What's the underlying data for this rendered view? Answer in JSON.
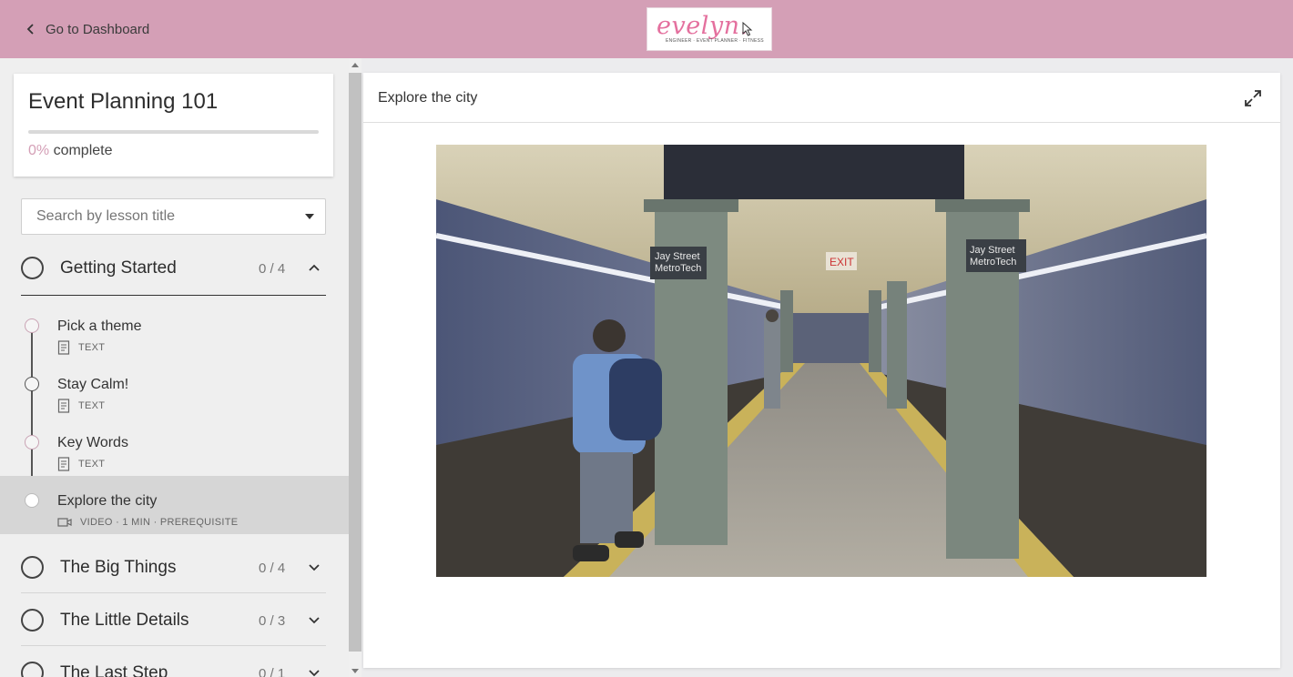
{
  "header": {
    "back_label": "Go to Dashboard",
    "logo_text": "evelyn.",
    "logo_tagline": "ENGINEER · EVENT PLANNER · FITNESS"
  },
  "colors": {
    "brand": "#d49fb6",
    "brand_logo": "#e4709e"
  },
  "course": {
    "title": "Event Planning 101",
    "progress_percent_text": "0%",
    "progress_suffix": " complete",
    "progress_value": 0
  },
  "search": {
    "placeholder": "Search by lesson title"
  },
  "sections": [
    {
      "title": "Getting Started",
      "count": "0 / 4",
      "expanded": true,
      "lessons": [
        {
          "title": "Pick a theme",
          "meta": "TEXT",
          "icon": "text-document-icon"
        },
        {
          "title": "Stay Calm!",
          "meta": "TEXT",
          "icon": "text-document-icon"
        },
        {
          "title": "Key Words",
          "meta": "TEXT",
          "icon": "text-document-icon"
        },
        {
          "title": "Explore the city",
          "meta": "VIDEO · 1 MIN · PREREQUISITE",
          "icon": "video-camera-icon",
          "active": true
        }
      ]
    },
    {
      "title": "The Big Things",
      "count": "0 / 4",
      "expanded": false
    },
    {
      "title": "The Little Details",
      "count": "0 / 3",
      "expanded": false
    },
    {
      "title": "The Last Step",
      "count": "0 / 1",
      "expanded": false
    }
  ],
  "content": {
    "title": "Explore the city",
    "expand_icon": "expand-arrows-icon",
    "video": {
      "sign_text": "Jay Street\nMetroTech",
      "exit_text": "EXIT"
    }
  }
}
